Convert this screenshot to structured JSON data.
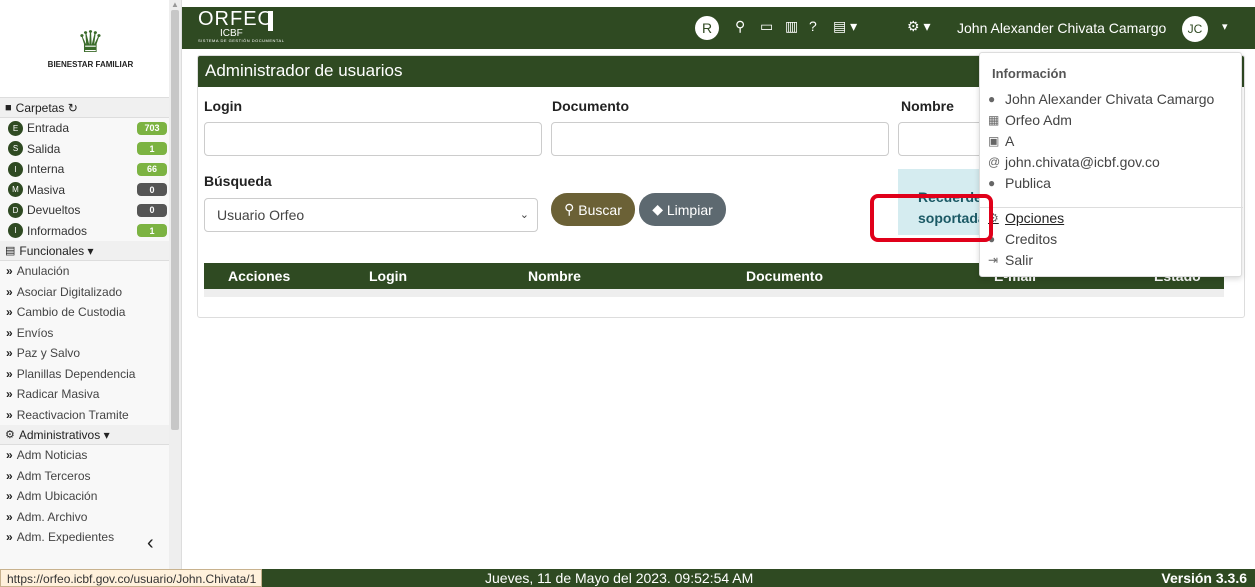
{
  "logo": {
    "text": "BIENESTAR FAMILIAR",
    "icon": "family-logo-icon"
  },
  "sidebar": {
    "carpetas_label": "Carpetas",
    "folders": [
      {
        "letter": "E",
        "label": "Entrada",
        "count": "703",
        "color": "#7cb342"
      },
      {
        "letter": "S",
        "label": "Salida",
        "count": "1",
        "color": "#7cb342"
      },
      {
        "letter": "I",
        "label": "Interna",
        "count": "66",
        "color": "#7cb342"
      },
      {
        "letter": "M",
        "label": "Masiva",
        "count": "0",
        "color": "#555555"
      },
      {
        "letter": "D",
        "label": "Devueltos",
        "count": "0",
        "color": "#555555"
      },
      {
        "letter": "I",
        "label": "Informados",
        "count": "1",
        "color": "#7cb342"
      }
    ],
    "funcionales_label": "Funcionales ▾",
    "funcionales": [
      "Anulación",
      "Asociar Digitalizado",
      "Cambio de Custodia",
      "Envíos",
      "Paz y Salvo",
      "Planillas Dependencia",
      "Radicar Masiva",
      "Reactivacion Tramite"
    ],
    "administrativos_label": "Administrativos ▾",
    "administrativos": [
      "Adm Noticias",
      "Adm Terceros",
      "Adm Ubicación",
      "Adm. Archivo",
      "Adm. Expedientes"
    ]
  },
  "topbar": {
    "brand": "ORFEO",
    "brand_sub": "ICBF",
    "brand_tagline": "SISTEMA DE GESTIÓN DOCUMENTAL",
    "r_badge": "R",
    "user_name": "John Alexander Chivata Camargo",
    "avatar": "JC"
  },
  "main": {
    "title": "Administrador de usuarios",
    "login_label": "Login",
    "documento_label": "Documento",
    "nombre_label": "Nombre",
    "busqueda_label": "Búsqueda",
    "select_value": "Usuario Orfeo",
    "buscar_label": "Buscar",
    "limpiar_label": "Limpiar",
    "alert_line1": "Recuerde",
    "alert_line2": "soportada",
    "columns": [
      "Acciones",
      "Login",
      "Nombre",
      "Documento",
      "E-mail",
      "Estado"
    ]
  },
  "dropdown": {
    "header": "Información",
    "name": "John Alexander Chivata Camargo",
    "dependency": "Orfeo Adm",
    "role": "A",
    "email": "john.chivata@icbf.gov.co",
    "status": "Publica",
    "opciones": "Opciones",
    "creditos": "Creditos",
    "salir": "Salir"
  },
  "footer": {
    "datetime": "Jueves, 11 de Mayo del 2023. 09:52:54 AM",
    "version": "Versión 3.3.6",
    "url": "https://orfeo.icbf.gov.co/usuario/John.Chivata/1"
  },
  "colors": {
    "primary": "#2f4a22",
    "badge_green": "#7cb342",
    "highlight": "#e0001a"
  }
}
